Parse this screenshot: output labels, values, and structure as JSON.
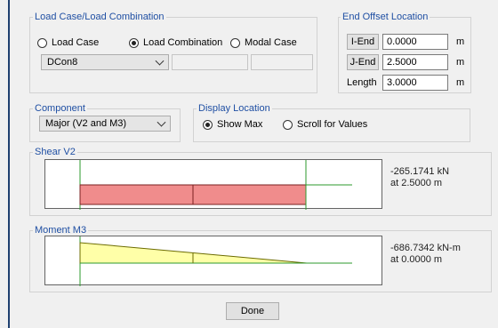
{
  "load_case_group": {
    "title": "Load Case/Load Combination",
    "radio_load_case": "Load Case",
    "radio_load_combination": "Load Combination",
    "radio_modal_case": "Modal Case",
    "selected": "Load Combination",
    "combo_value": "DCon8",
    "disabled_field_1": "",
    "disabled_field_2": ""
  },
  "end_offset": {
    "title": "End Offset Location",
    "i_end_label": "I-End",
    "i_end_value": "0.0000",
    "j_end_label": "J-End",
    "j_end_value": "2.5000",
    "length_label": "Length",
    "length_value": "3.0000",
    "unit": "m"
  },
  "component": {
    "title": "Component",
    "value": "Major (V2 and M3)"
  },
  "display_location": {
    "title": "Display Location",
    "show_max": "Show Max",
    "scroll_values": "Scroll for Values",
    "selected": "Show Max"
  },
  "shear": {
    "title": "Shear V2",
    "value_text": "-265.1741 kN",
    "location_text": "at 2.5000 m",
    "fill_color": "#f08c8c"
  },
  "moment": {
    "title": "Moment M3",
    "value_text": "-686.7342 kN-m",
    "location_text": "at 0.0000 m",
    "fill_color": "#ffffa8"
  },
  "done_label": "Done",
  "colors": {
    "group_title": "#1f4fa3",
    "cursor_line": "#2e9a2e"
  }
}
